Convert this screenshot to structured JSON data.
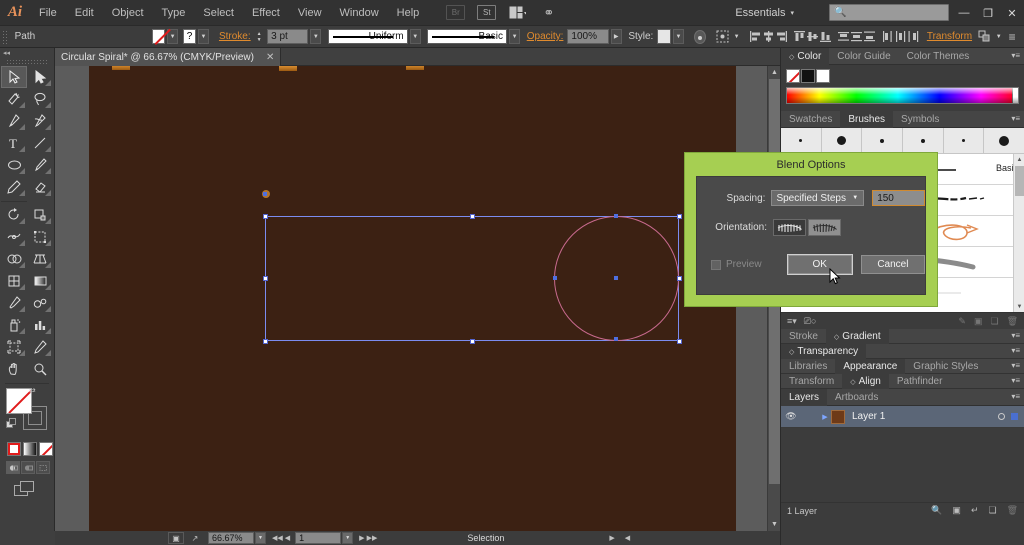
{
  "app": {
    "name": "Adobe Illustrator",
    "logo": "Ai"
  },
  "menubar": {
    "items": [
      "File",
      "Edit",
      "Object",
      "Type",
      "Select",
      "Effect",
      "View",
      "Window",
      "Help"
    ],
    "icons": [
      "bridge-icon",
      "stock-icon",
      "arrange-documents-icon",
      "power-icon"
    ],
    "workspace": "Essentials",
    "workspace_caret": "▾",
    "search_placeholder": "",
    "search_icon": "search-icon",
    "window_controls": {
      "minimize": "—",
      "restore": "❐",
      "close": "✕"
    }
  },
  "controlbar": {
    "object_label": "Path",
    "fill_swatch": "none-swatch",
    "stroke_swatch": "?",
    "stroke_label": "Stroke:",
    "stroke_weight": "3 pt",
    "profile": "Uniform",
    "brush_definition": "Basic",
    "opacity_label": "Opacity:",
    "opacity_value": "100%",
    "style_label": "Style:",
    "transform_label": "Transform",
    "align_icons": [
      "align-left-icon",
      "align-center-horizontal-icon",
      "align-right-icon",
      "align-top-icon",
      "align-middle-icon",
      "align-bottom-icon",
      "distribute-top-icon",
      "distribute-center-icon",
      "distribute-bottom-icon",
      "distribute-left-icon",
      "distribute-center-vertical-icon",
      "distribute-right-icon"
    ],
    "panel_menu_icon": "panel-menu-icon"
  },
  "document": {
    "tab_title": "Circular Spiral* @ 66.67% (CMYK/Preview)",
    "close_icon": "✕"
  },
  "toolbar": {
    "tools": [
      {
        "name": "selection-tool",
        "selected": true
      },
      {
        "name": "direct-selection-tool",
        "selected": false
      },
      {
        "name": "magic-wand-tool",
        "selected": false
      },
      {
        "name": "lasso-tool",
        "selected": false
      },
      {
        "name": "pen-tool",
        "selected": false
      },
      {
        "name": "curvature-tool",
        "selected": false
      },
      {
        "name": "type-tool",
        "selected": false
      },
      {
        "name": "line-segment-tool",
        "selected": false
      },
      {
        "name": "ellipse-tool",
        "selected": false
      },
      {
        "name": "paintbrush-tool",
        "selected": false
      },
      {
        "name": "pencil-tool",
        "selected": false
      },
      {
        "name": "eraser-tool",
        "selected": false
      },
      {
        "name": "rotate-tool",
        "selected": false
      },
      {
        "name": "scale-tool",
        "selected": false
      },
      {
        "name": "width-tool",
        "selected": false
      },
      {
        "name": "free-transform-tool",
        "selected": false
      },
      {
        "name": "shape-builder-tool",
        "selected": false
      },
      {
        "name": "perspective-grid-tool",
        "selected": false
      },
      {
        "name": "mesh-tool",
        "selected": false
      },
      {
        "name": "gradient-tool",
        "selected": false
      },
      {
        "name": "eyedropper-tool",
        "selected": false
      },
      {
        "name": "blend-tool",
        "selected": false
      },
      {
        "name": "symbol-sprayer-tool",
        "selected": false
      },
      {
        "name": "column-graph-tool",
        "selected": false
      },
      {
        "name": "artboard-tool",
        "selected": false
      },
      {
        "name": "slice-tool",
        "selected": false
      },
      {
        "name": "hand-tool",
        "selected": false
      },
      {
        "name": "zoom-tool",
        "selected": false
      }
    ],
    "fill_swatch": "none-fill-swatch",
    "stroke_swatch": "stroke-swatch",
    "color_modes": [
      "color-mode-button",
      "gradient-mode-button",
      "none-mode-button"
    ],
    "draw_modes": [
      "draw-normal-button",
      "draw-behind-button",
      "draw-inside-button"
    ],
    "screen_mode": "change-screen-mode-button"
  },
  "canvas": {
    "background_color": "#3c2113",
    "artboard_marks": 3,
    "shapes": {
      "selection_bbox": "selection-bounding-box",
      "circle_stroke_color": "#c86a8e",
      "handle_color": "#ffffff",
      "anchor_color": "#4f6fe0"
    },
    "scrollbar_v": "canvas-vertical-scrollbar",
    "scrollbar_h": "canvas-horizontal-scrollbar"
  },
  "statusbar": {
    "zoom_value": "66.67%",
    "artboard_number": "1",
    "status_text": "Selection",
    "nav_first": "◀◀",
    "nav_prev": "◀",
    "nav_next": "▶",
    "nav_last": "▶▶"
  },
  "dock": {
    "color_group": {
      "tabs": [
        {
          "label": "Color",
          "active": true,
          "caret": "◇"
        },
        {
          "label": "Color Guide",
          "active": false
        },
        {
          "label": "Color Themes",
          "active": false
        }
      ],
      "swatches": [
        "none",
        "black",
        "white"
      ],
      "spectrum": "color-spectrum-ramp"
    },
    "brushes_group": {
      "tabs": [
        {
          "label": "Swatches",
          "active": false
        },
        {
          "label": "Brushes",
          "active": true
        },
        {
          "label": "Symbols",
          "active": false
        }
      ],
      "calligraphic_sizes": [
        3,
        7,
        4,
        4,
        3,
        8
      ],
      "list_items": [
        {
          "name": "Basic",
          "type": "basic-stroke"
        },
        {
          "name": "",
          "type": "charcoal-brush"
        },
        {
          "name": "",
          "type": "arrow-art-brush"
        },
        {
          "name": "",
          "type": "gray-stroke-brush"
        },
        {
          "name": "",
          "type": "blue-pattern-brush"
        }
      ],
      "footer_icons": [
        "brush-libraries-icon",
        "libraries-panel-icon",
        "options-icon",
        "remove-brush-link-icon",
        "new-brush-icon",
        "delete-brush-icon"
      ]
    },
    "strip_tabs": [
      {
        "row": [
          {
            "label": "Stroke",
            "active": false
          },
          {
            "label": "Gradient",
            "active": true,
            "caret": "◇"
          }
        ]
      },
      {
        "row": [
          {
            "label": "Transparency",
            "active": true,
            "caret": "◇"
          }
        ]
      },
      {
        "row": [
          {
            "label": "Libraries",
            "active": false
          },
          {
            "label": "Appearance",
            "active": true
          },
          {
            "label": "Graphic Styles",
            "active": false
          }
        ]
      },
      {
        "row": [
          {
            "label": "Transform",
            "active": false
          },
          {
            "label": "Align",
            "active": true,
            "caret": "◇"
          },
          {
            "label": "Pathfinder",
            "active": false
          }
        ]
      }
    ],
    "layers_group": {
      "tabs": [
        {
          "label": "Layers",
          "active": true
        },
        {
          "label": "Artboards",
          "active": false
        }
      ],
      "rows": [
        {
          "name": "Layer 1",
          "color": "#6e3a18",
          "visible": true,
          "selected": true
        }
      ],
      "footer_text": "1 Layer",
      "footer_icons": [
        "locate-object-icon",
        "make-clipping-mask-icon",
        "create-new-sublayer-icon",
        "create-new-layer-icon",
        "delete-selection-icon"
      ]
    }
  },
  "dialog": {
    "title": "Blend Options",
    "title_bar_color": "#a6cf52",
    "spacing_label": "Spacing:",
    "spacing_value": "Specified Steps",
    "spacing_caret": "▼",
    "steps_value": "150",
    "orientation_label": "Orientation:",
    "orientation_options": [
      "align-to-page-button",
      "align-to-path-button"
    ],
    "preview_label": "Preview",
    "preview_checked": false,
    "ok_label": "OK",
    "cancel_label": "Cancel"
  }
}
